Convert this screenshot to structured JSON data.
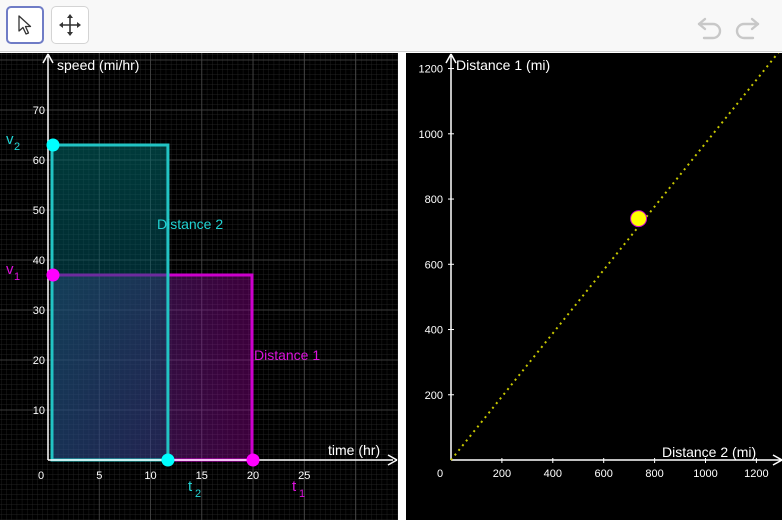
{
  "toolbar": {
    "tools": [
      {
        "name": "select",
        "icon": "cursor-arrow-icon",
        "active": true
      },
      {
        "name": "move",
        "icon": "move-arrows-icon",
        "active": false
      }
    ],
    "undo_icon": "undo-icon",
    "redo_icon": "redo-icon"
  },
  "left_graph": {
    "y_axis_label": "speed (mi/hr)",
    "x_axis_label": "time (hr)",
    "x_ticks": [
      "0",
      "5",
      "10",
      "15",
      "20",
      "25"
    ],
    "y_ticks": [
      "10",
      "20",
      "30",
      "40",
      "50",
      "60",
      "70"
    ],
    "v1_label": "v",
    "v1_sub": "1",
    "v2_label": "v",
    "v2_sub": "2",
    "t1_label": "t",
    "t1_sub": "1",
    "t2_label": "t",
    "t2_sub": "2",
    "distance1_label": "Distance 1",
    "distance2_label": "Distance 2",
    "values": {
      "v1": 37,
      "t1": 20,
      "v2": 63,
      "t2": 11.7
    },
    "colors": {
      "distance1": "#cc00cc",
      "distance2": "#00cccc",
      "point1": "#ff00ff",
      "point2": "#00ffff"
    }
  },
  "right_graph": {
    "y_axis_label": "Distance 1 (mi)",
    "x_axis_label": "Distance 2 (mi)",
    "x_ticks": [
      "0",
      "200",
      "400",
      "600",
      "800",
      "1000",
      "1200"
    ],
    "y_ticks": [
      "200",
      "400",
      "600",
      "800",
      "1000",
      "1200"
    ],
    "point": {
      "x": 737,
      "y": 740
    },
    "point_color": "#ffff00",
    "line_color": "#c8c800"
  }
}
